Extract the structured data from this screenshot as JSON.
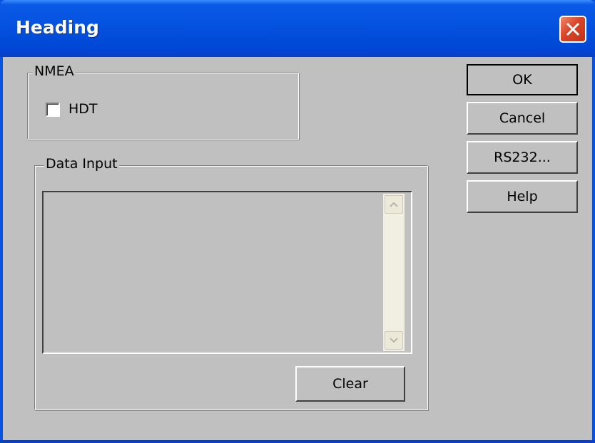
{
  "window": {
    "title": "Heading"
  },
  "nmea_group": {
    "label": "NMEA",
    "hdt_label": "HDT",
    "hdt_checked": false
  },
  "data_input_group": {
    "label": "Data Input",
    "clear_label": "Clear"
  },
  "buttons": {
    "ok": "OK",
    "cancel": "Cancel",
    "rs232": "RS232...",
    "help": "Help"
  },
  "icons": {
    "close": "close-icon",
    "scroll_up": "arrow-up-icon",
    "scroll_down": "arrow-down-icon"
  },
  "colors": {
    "titlebar": "#0553e0",
    "close": "#d8442a",
    "face": "#c0c0c0"
  }
}
